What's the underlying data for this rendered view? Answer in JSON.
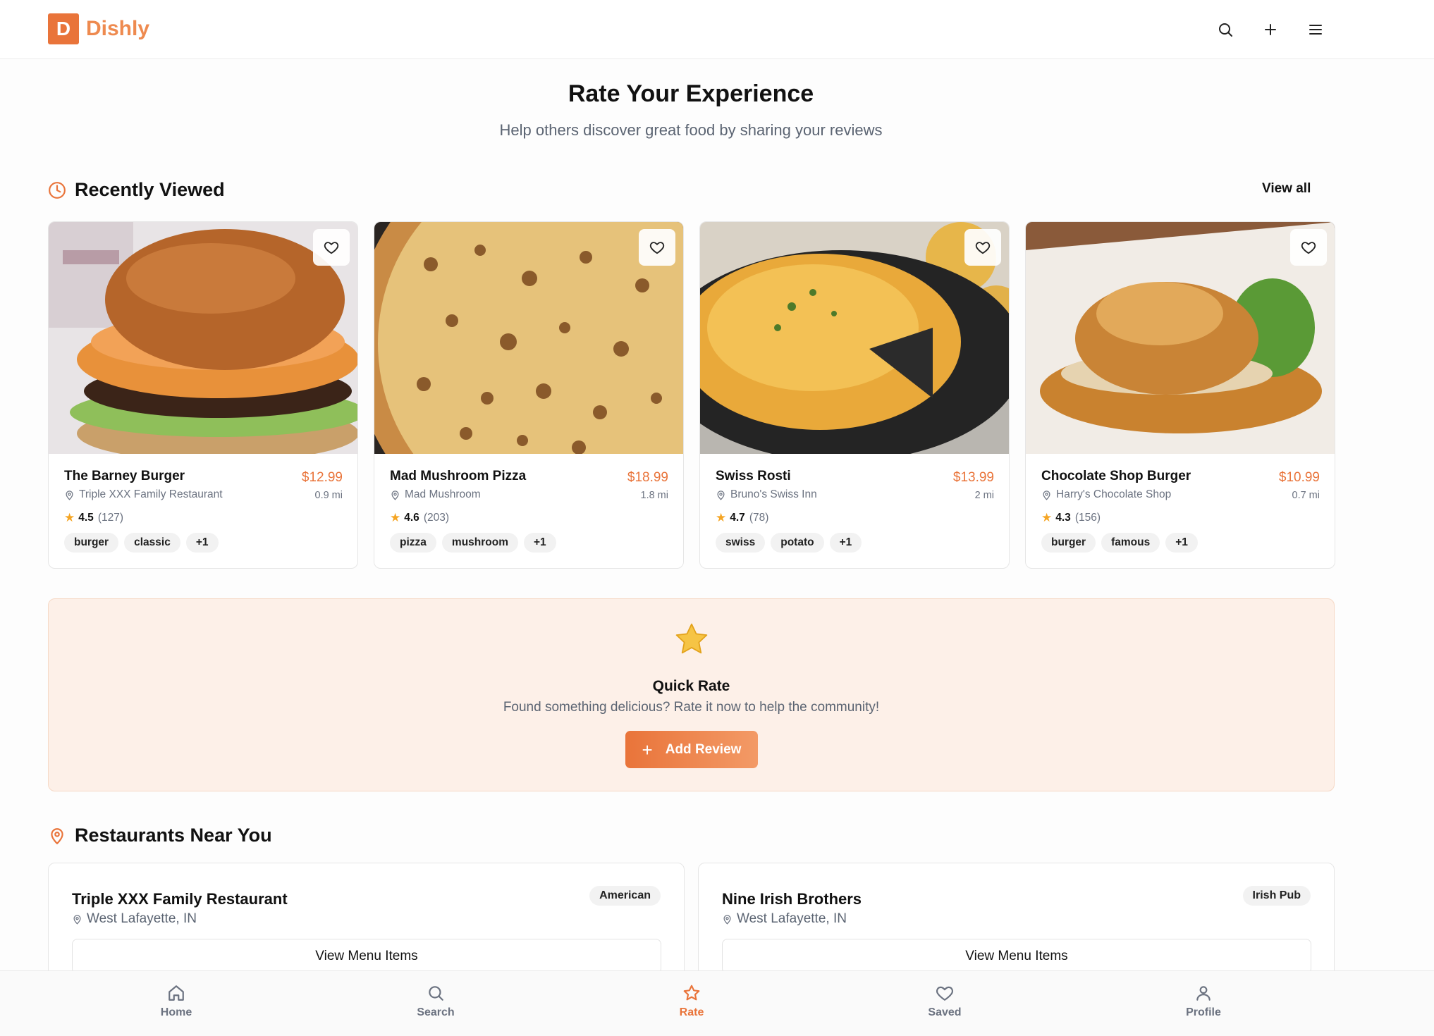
{
  "header": {
    "logo_letter": "D",
    "brand": "Dishly",
    "icons": [
      "search-icon",
      "plus-icon",
      "menu-icon"
    ]
  },
  "hero": {
    "title": "Rate Your Experience",
    "subtitle": "Help others discover great food by sharing your reviews"
  },
  "recently_viewed": {
    "title": "Recently Viewed",
    "view_all": "View all",
    "items": [
      {
        "name": "The Barney Burger",
        "price": "$12.99",
        "restaurant": "Triple XXX Family Restaurant",
        "distance": "0.9 mi",
        "rating": "4.5",
        "reviews": "(127)",
        "tags": [
          "burger",
          "classic",
          "+1"
        ]
      },
      {
        "name": "Mad Mushroom Pizza",
        "price": "$18.99",
        "restaurant": "Mad Mushroom",
        "distance": "1.8 mi",
        "rating": "4.6",
        "reviews": "(203)",
        "tags": [
          "pizza",
          "mushroom",
          "+1"
        ]
      },
      {
        "name": "Swiss Rosti",
        "price": "$13.99",
        "restaurant": "Bruno's Swiss Inn",
        "distance": "2 mi",
        "rating": "4.7",
        "reviews": "(78)",
        "tags": [
          "swiss",
          "potato",
          "+1"
        ]
      },
      {
        "name": "Chocolate Shop Burger",
        "price": "$10.99",
        "restaurant": "Harry's Chocolate Shop",
        "distance": "0.7 mi",
        "rating": "4.3",
        "reviews": "(156)",
        "tags": [
          "burger",
          "famous",
          "+1"
        ]
      }
    ]
  },
  "quick_rate": {
    "title": "Quick Rate",
    "subtitle": "Found something delicious? Rate it now to help the community!",
    "button": "Add Review"
  },
  "nearby": {
    "title": "Restaurants Near You",
    "restaurants": [
      {
        "name": "Triple XXX Family Restaurant",
        "cuisine": "American",
        "location": "West Lafayette, IN",
        "button": "View Menu Items"
      },
      {
        "name": "Nine Irish Brothers",
        "cuisine": "Irish Pub",
        "location": "West Lafayette, IN",
        "button": "View Menu Items"
      }
    ]
  },
  "bottom_nav": [
    {
      "label": "Home",
      "icon": "home-icon"
    },
    {
      "label": "Search",
      "icon": "search-icon"
    },
    {
      "label": "Rate",
      "icon": "star-icon",
      "active": true
    },
    {
      "label": "Saved",
      "icon": "heart-icon"
    },
    {
      "label": "Profile",
      "icon": "user-icon"
    }
  ],
  "colors": {
    "accent": "#e9743a",
    "quick_rate_bg": "#fdf0e8",
    "star": "#f5a524"
  }
}
